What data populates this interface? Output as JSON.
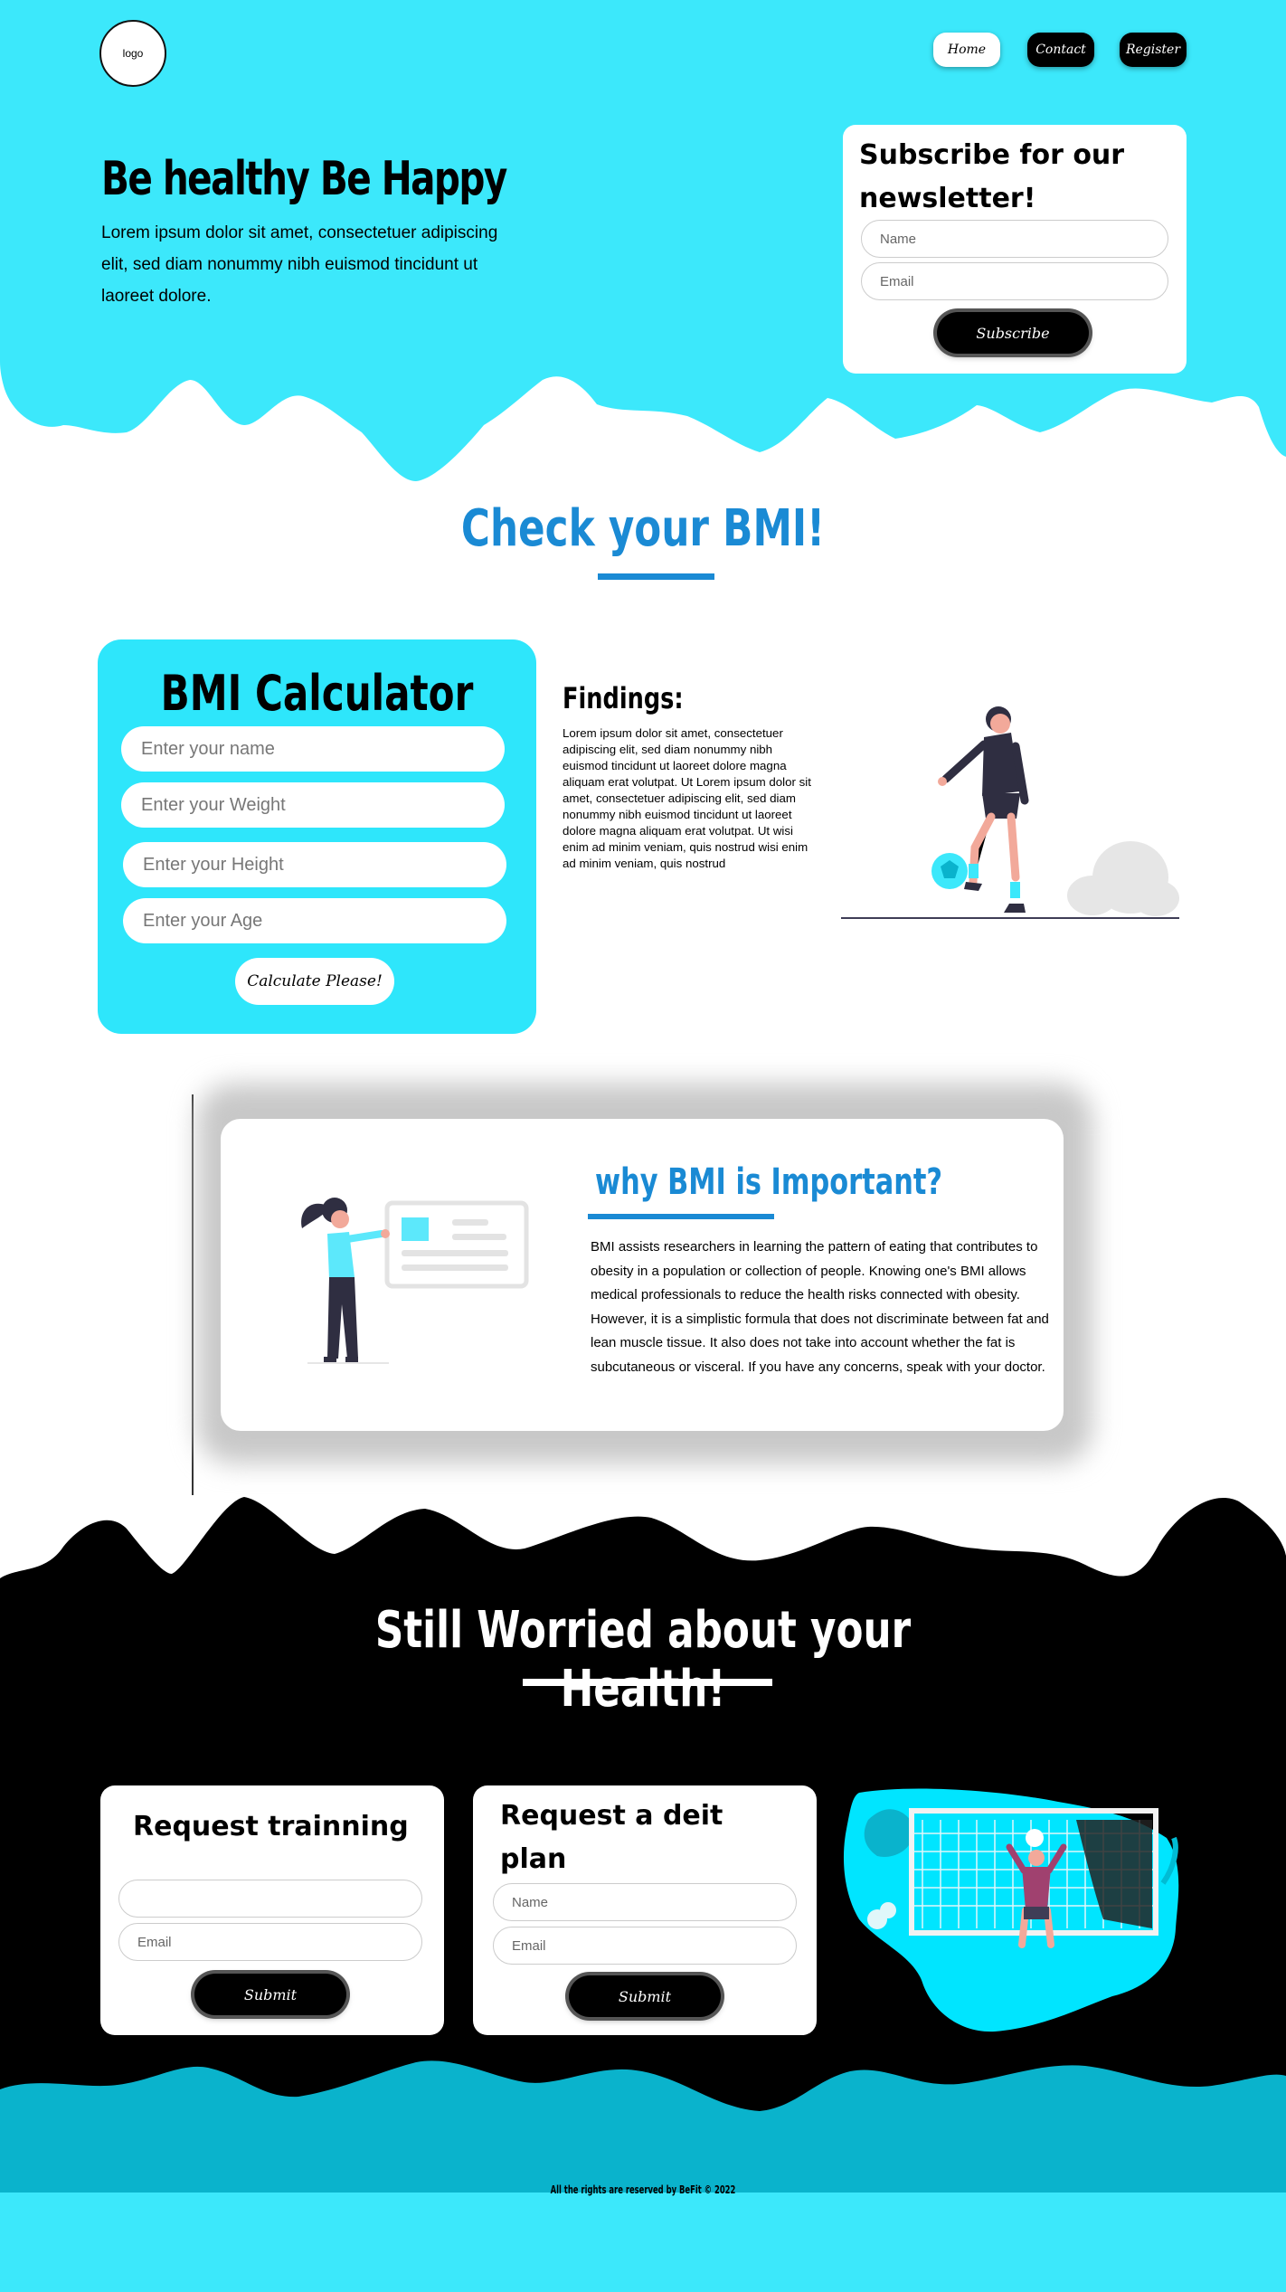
{
  "header": {
    "logo_text": "logo",
    "nav": {
      "home": "Home",
      "contact": "Contact",
      "register": "Register"
    }
  },
  "hero": {
    "title": "Be healthy Be Happy",
    "text": "Lorem ipsum dolor sit amet, consectetuer adipiscing elit, sed diam nonummy nibh euismod tincidunt ut laoreet dolore."
  },
  "newsletter": {
    "title": "Subscribe for our newsletter!",
    "name_placeholder": "Name",
    "email_placeholder": "Email",
    "button": "Subscribe"
  },
  "bmi": {
    "heading": "Check your BMI!",
    "calculator": {
      "title": "BMI Calculator",
      "name_placeholder": "Enter your name",
      "weight_placeholder": "Enter your Weight",
      "height_placeholder": "Enter your Height",
      "age_placeholder": "Enter your Age",
      "button": "Calculate Please!"
    },
    "findings": {
      "title": "Findings:",
      "text": "Lorem ipsum dolor sit amet, consectetuer adipiscing elit, sed diam nonummy nibh euismod tincidunt ut laoreet dolore magna aliquam erat volutpat. Ut Lorem ipsum dolor sit amet, consectetuer adipiscing elit, sed diam nonummy nibh euismod tincidunt ut laoreet dolore magna aliquam erat volutpat. Ut wisi enim ad minim veniam, quis nostrud wisi enim ad minim veniam, quis nostrud"
    }
  },
  "why": {
    "title": "why BMI is Important?",
    "text": "BMI assists researchers in learning the pattern of eating that contributes to obesity in a population or collection of people. Knowing one's BMI allows medical professionals to reduce the health risks connected with obesity. However, it is a simplistic formula that does not discriminate between fat and lean muscle tissue. It also does not take into account whether the fat is subcutaneous or visceral. If you have any concerns, speak with your doctor."
  },
  "worried": {
    "heading": "Still Worried about your Health!",
    "training": {
      "title": "Request trainning",
      "name_placeholder": "",
      "email_placeholder": "Email",
      "button": "Submit"
    },
    "diet": {
      "title": "Request a deit plan",
      "name_placeholder": "Name",
      "email_placeholder": "Email",
      "button": "Submit"
    }
  },
  "footer": {
    "text": "All the rights are reserved by BeFit © 2022"
  },
  "colors": {
    "cyan": "#3ce8fb",
    "teal": "#0ab3cc",
    "blue": "#1a8ad4",
    "black": "#000000"
  }
}
